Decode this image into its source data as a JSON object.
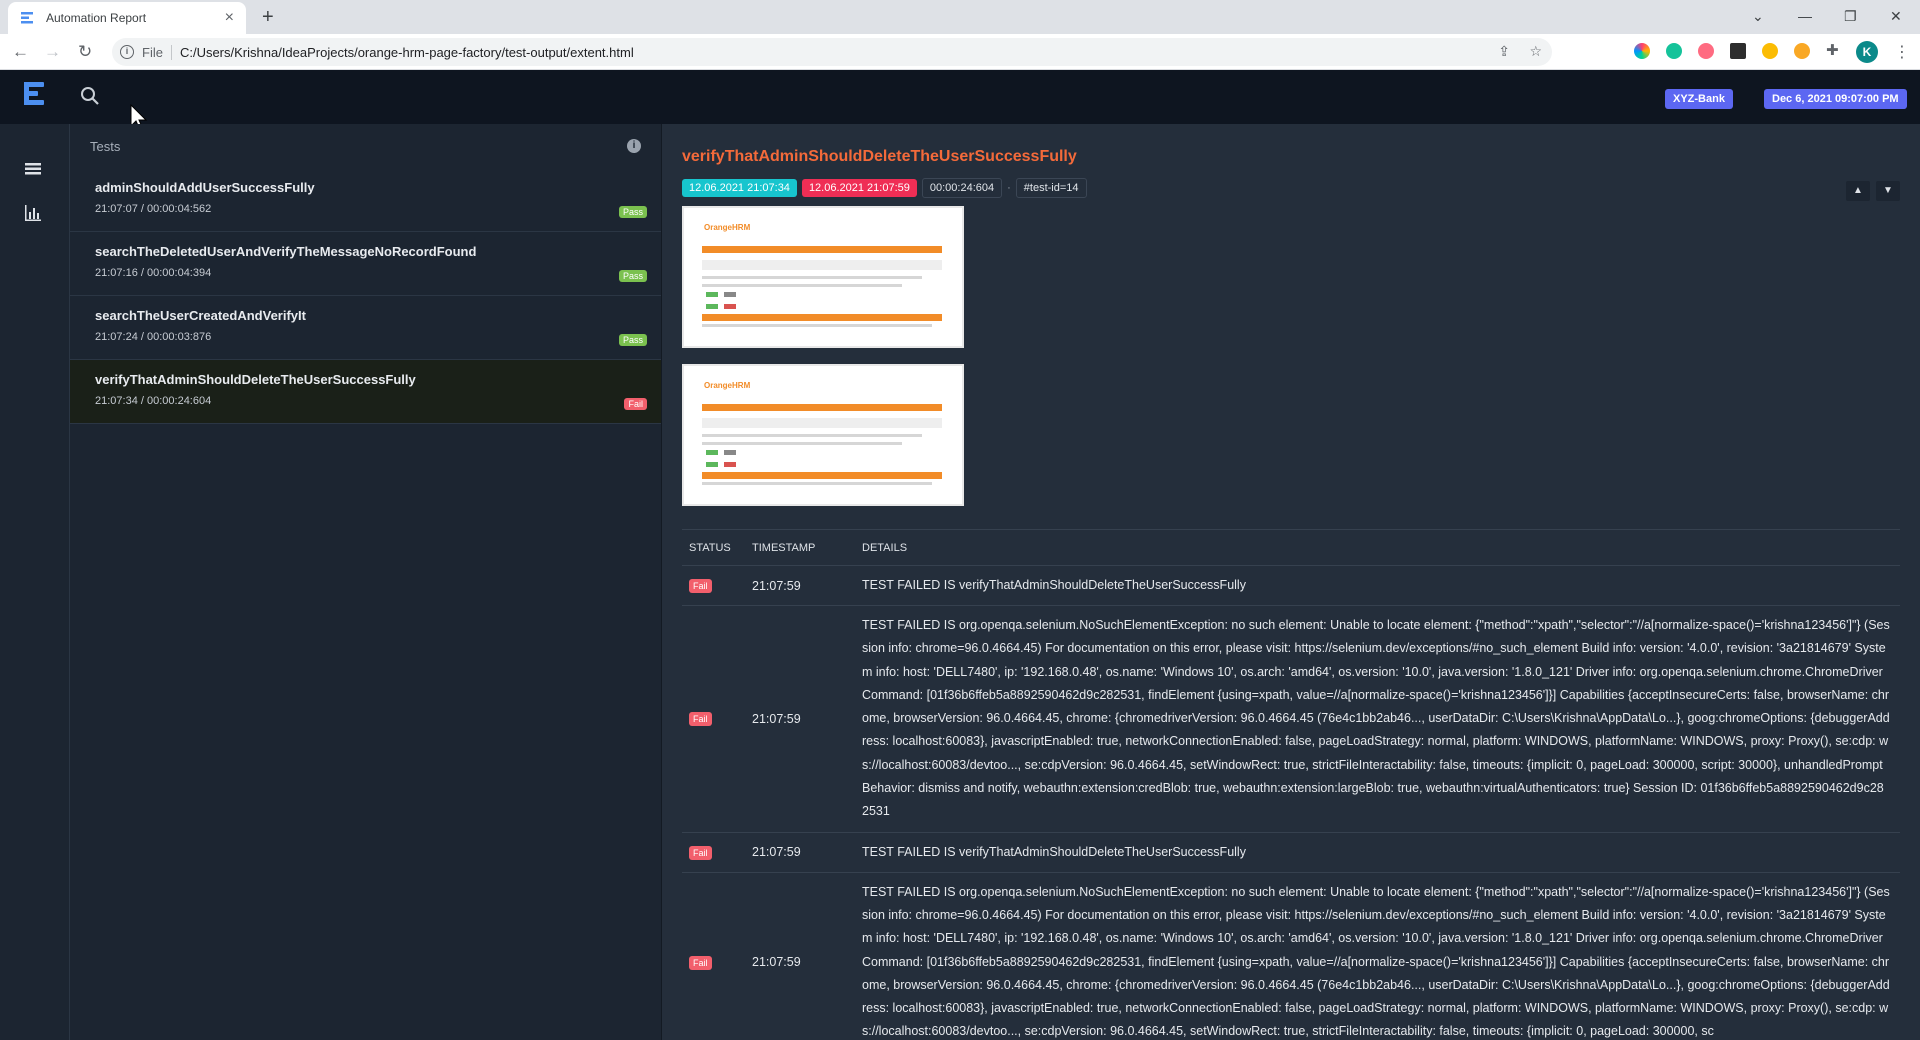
{
  "browser": {
    "tab_title": "Automation Report",
    "scheme": "File",
    "url": "C:/Users/Krishna/IdeaProjects/orange-hrm-page-factory/test-output/extent.html",
    "profile_initial": "K"
  },
  "header": {
    "badge_bank": "XYZ-Bank",
    "badge_date": "Dec 6, 2021 09:07:00 PM"
  },
  "tests_panel": {
    "title": "Tests",
    "items": [
      {
        "name": "adminShouldAddUserSuccessFully",
        "meta": "21:07:07 / 00:00:04:562",
        "status": "Pass"
      },
      {
        "name": "searchTheDeletedUserAndVerifyTheMessageNoRecordFound",
        "meta": "21:07:16 / 00:00:04:394",
        "status": "Pass"
      },
      {
        "name": "searchTheUserCreatedAndVerifyIt",
        "meta": "21:07:24 / 00:00:03:876",
        "status": "Pass"
      },
      {
        "name": "verifyThatAdminShouldDeleteTheUserSuccessFully",
        "meta": "21:07:34 / 00:00:24:604",
        "status": "Fail"
      }
    ]
  },
  "detail": {
    "title": "verifyThatAdminShouldDeleteTheUserSuccessFully",
    "start": "12.06.2021 21:07:34",
    "end": "12.06.2021 21:07:59",
    "duration": "00:00:24:604",
    "separator": "·",
    "test_id": "#test-id=14",
    "table": {
      "headers": [
        "STATUS",
        "TIMESTAMP",
        "DETAILS"
      ],
      "rows": [
        {
          "status": "Fail",
          "time": "21:07:59",
          "details": "TEST FAILED IS verifyThatAdminShouldDeleteTheUserSuccessFully"
        },
        {
          "status": "Fail",
          "time": "21:07:59",
          "details": "TEST FAILED IS org.openqa.selenium.NoSuchElementException: no such element: Unable to locate element: {\"method\":\"xpath\",\"selector\":\"//a[normalize-space()='krishna123456']\"} (Session info: chrome=96.0.4664.45) For documentation on this error, please visit: https://selenium.dev/exceptions/#no_such_element Build info: version: '4.0.0', revision: '3a21814679' System info: host: 'DELL7480', ip: '192.168.0.48', os.name: 'Windows 10', os.arch: 'amd64', os.version: '10.0', java.version: '1.8.0_121' Driver info: org.openqa.selenium.chrome.ChromeDriver Command: [01f36b6ffeb5a8892590462d9c282531, findElement {using=xpath, value=//a[normalize-space()='krishna123456']}] Capabilities {acceptInsecureCerts: false, browserName: chrome, browserVersion: 96.0.4664.45, chrome: {chromedriverVersion: 96.0.4664.45 (76e4c1bb2ab46..., userDataDir: C:\\Users\\Krishna\\AppData\\Lo...}, goog:chromeOptions: {debuggerAddress: localhost:60083}, javascriptEnabled: true, networkConnectionEnabled: false, pageLoadStrategy: normal, platform: WINDOWS, platformName: WINDOWS, proxy: Proxy(), se:cdp: ws://localhost:60083/devtoo..., se:cdpVersion: 96.0.4664.45, setWindowRect: true, strictFileInteractability: false, timeouts: {implicit: 0, pageLoad: 300000, script: 30000}, unhandledPromptBehavior: dismiss and notify, webauthn:extension:credBlob: true, webauthn:extension:largeBlob: true, webauthn:virtualAuthenticators: true} Session ID: 01f36b6ffeb5a8892590462d9c282531"
        },
        {
          "status": "Fail",
          "time": "21:07:59",
          "details": "TEST FAILED IS verifyThatAdminShouldDeleteTheUserSuccessFully"
        },
        {
          "status": "Fail",
          "time": "21:07:59",
          "details": "TEST FAILED IS org.openqa.selenium.NoSuchElementException: no such element: Unable to locate element: {\"method\":\"xpath\",\"selector\":\"//a[normalize-space()='krishna123456']\"} (Session info: chrome=96.0.4664.45) For documentation on this error, please visit: https://selenium.dev/exceptions/#no_such_element Build info: version: '4.0.0', revision: '3a21814679' System info: host: 'DELL7480', ip: '192.168.0.48', os.name: 'Windows 10', os.arch: 'amd64', os.version: '10.0', java.version: '1.8.0_121' Driver info: org.openqa.selenium.chrome.ChromeDriver Command: [01f36b6ffeb5a8892590462d9c282531, findElement {using=xpath, value=//a[normalize-space()='krishna123456']}] Capabilities {acceptInsecureCerts: false, browserName: chrome, browserVersion: 96.0.4664.45, chrome: {chromedriverVersion: 96.0.4664.45 (76e4c1bb2ab46..., userDataDir: C:\\Users\\Krishna\\AppData\\Lo...}, goog:chromeOptions: {debuggerAddress: localhost:60083}, javascriptEnabled: true, networkConnectionEnabled: false, pageLoadStrategy: normal, platform: WINDOWS, platformName: WINDOWS, proxy: Proxy(), se:cdp: ws://localhost:60083/devtoo..., se:cdpVersion: 96.0.4664.45, setWindowRect: true, strictFileInteractability: false, timeouts: {implicit: 0, pageLoad: 300000, sc"
        }
      ]
    }
  },
  "colors": {
    "accent_title": "#f46a3a",
    "pass": "#7bc14f",
    "fail": "#f25f6c",
    "start_tag": "#17c5ce",
    "end_tag": "#ef2e55",
    "header_badge": "#5c67f2"
  },
  "icons": {
    "nav": [
      "list-icon",
      "bar-chart-icon"
    ],
    "header": [
      "logo-icon",
      "search-icon"
    ]
  }
}
